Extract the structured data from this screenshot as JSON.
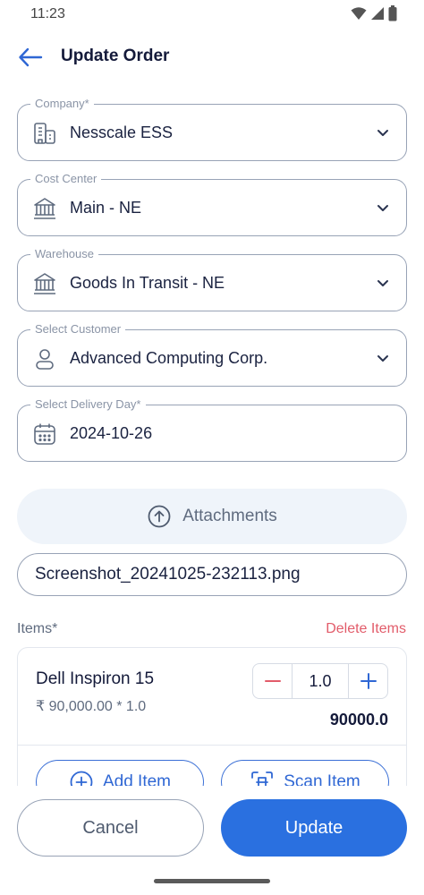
{
  "status_bar": {
    "time": "11:23"
  },
  "header": {
    "title": "Update Order"
  },
  "fields": {
    "company": {
      "label": "Company*",
      "value": "Nesscale ESS"
    },
    "cost_center": {
      "label": "Cost Center",
      "value": "Main - NE"
    },
    "warehouse": {
      "label": "Warehouse",
      "value": "Goods In Transit - NE"
    },
    "customer": {
      "label": "Select Customer",
      "value": "Advanced Computing Corp."
    },
    "delivery_day": {
      "label": "Select Delivery Day*",
      "value": "2024-10-26"
    }
  },
  "attachments": {
    "label": "Attachments",
    "file_name": "Screenshot_20241025-232113.png"
  },
  "items": {
    "label": "Items*",
    "delete_label": "Delete Items",
    "list": [
      {
        "name": "Dell Inspiron 15",
        "price_line": "₹ 90,000.00 * 1.0",
        "qty": "1.0",
        "total": "90000.0"
      }
    ],
    "add_label": "Add Item",
    "scan_label": "Scan Item"
  },
  "actions": {
    "cancel_label": "Cancel",
    "update_label": "Update"
  },
  "colors": {
    "primary": "#2a70e0",
    "danger": "#e25c6a",
    "border": "#98a3b6",
    "text": "#1a2240"
  }
}
